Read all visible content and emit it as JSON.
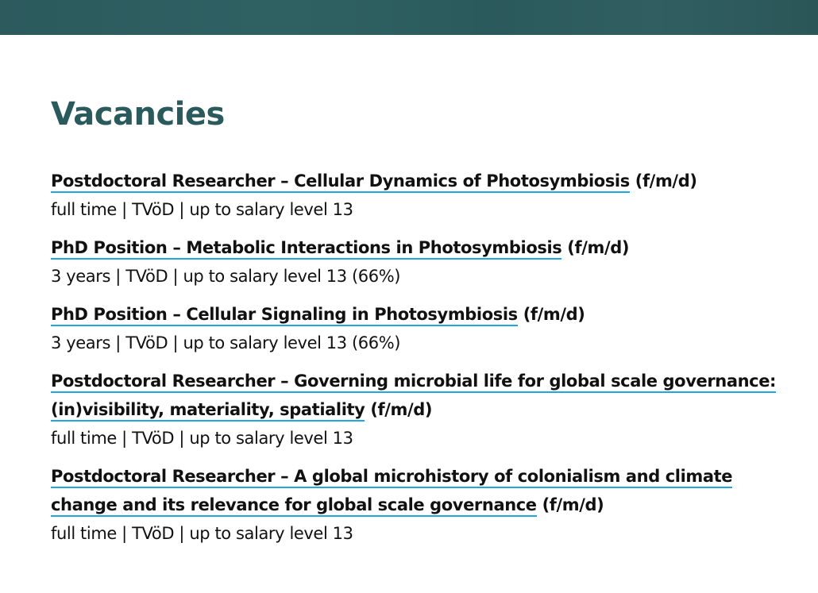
{
  "page": {
    "title": "Vacancies"
  },
  "vacancies": [
    {
      "link": "Postdoctoral Researcher – Cellular Dynamics of Photosymbiosis",
      "suffix": "(f/m/d)",
      "meta": "full time | TVöD | up to salary level 13"
    },
    {
      "link": "PhD Position – Metabolic Interactions in Photosymbiosis",
      "suffix": "(f/m/d)",
      "meta": "3 years | TVöD | up to salary level 13 (66%)"
    },
    {
      "link": "PhD Position – Cellular Signaling in Photosymbiosis",
      "suffix": "(f/m/d)",
      "meta": "3 years | TVöD | up to salary level 13 (66%)"
    },
    {
      "link": "Postdoctoral Researcher – Governing microbial life for global scale governance: (in)visibility, materiality, spatiality",
      "suffix": "(f/m/d)",
      "meta": "full time | TVöD | up to salary level 13"
    },
    {
      "link": "Postdoctoral Researcher – A global microhistory of colonialism and climate change and its relevance for global scale governance",
      "suffix": "(f/m/d)",
      "meta": "full time | TVöD | up to salary level 13"
    }
  ]
}
